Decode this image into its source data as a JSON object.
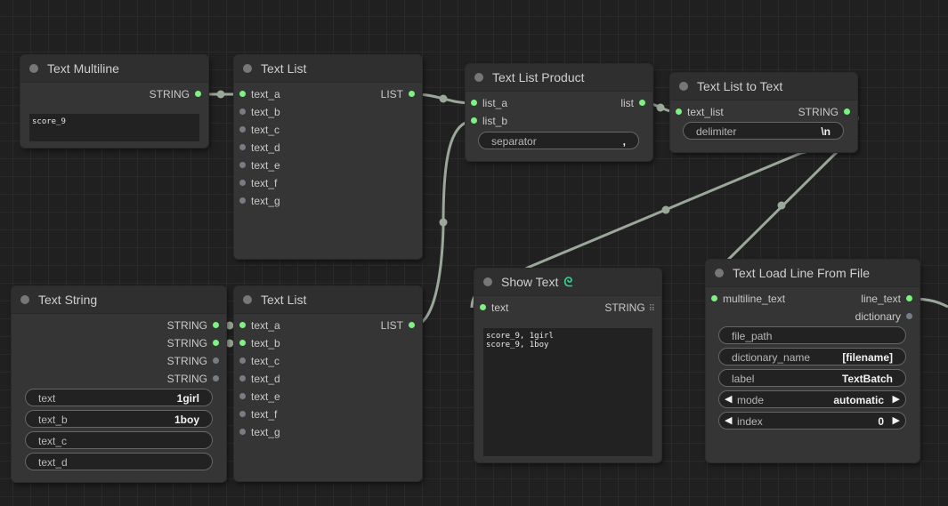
{
  "nodes": {
    "text_multiline": {
      "title": "Text Multiline",
      "output": "STRING",
      "text": "score_9"
    },
    "text_list_1": {
      "title": "Text List",
      "inputs": [
        "text_a",
        "text_b",
        "text_c",
        "text_d",
        "text_e",
        "text_f",
        "text_g"
      ],
      "output": "LIST"
    },
    "text_list_product": {
      "title": "Text List Product",
      "inputs": [
        "list_a",
        "list_b"
      ],
      "output": "list",
      "separator": {
        "label": "separator",
        "value": ","
      }
    },
    "text_list_to_text": {
      "title": "Text List to Text",
      "input": "text_list",
      "output": "STRING",
      "delimiter": {
        "label": "delimiter",
        "value": "\\n"
      }
    },
    "text_string": {
      "title": "Text String",
      "outputs": [
        "STRING",
        "STRING",
        "STRING",
        "STRING"
      ],
      "widgets": [
        {
          "label": "text",
          "value": "1girl"
        },
        {
          "label": "text_b",
          "value": "1boy"
        },
        {
          "label": "text_c",
          "value": ""
        },
        {
          "label": "text_d",
          "value": ""
        }
      ]
    },
    "text_list_2": {
      "title": "Text List",
      "inputs": [
        "text_a",
        "text_b",
        "text_c",
        "text_d",
        "text_e",
        "text_f",
        "text_g"
      ],
      "output": "LIST"
    },
    "show_text": {
      "title": "Show Text",
      "input": "text",
      "output": "STRING",
      "text": "score_9, 1girl\nscore_9, 1boy",
      "icon": "chain-link-icon"
    },
    "text_load_line": {
      "title": "Text Load Line From File",
      "input": "multiline_text",
      "outputs": [
        "line_text",
        "dictionary"
      ],
      "widgets": {
        "file_path": {
          "label": "file_path",
          "value": ""
        },
        "dictionary_name": {
          "label": "dictionary_name",
          "value": "[filename]"
        },
        "label": {
          "label": "label",
          "value": "TextBatch"
        },
        "mode": {
          "label": "mode",
          "value": "automatic"
        },
        "index": {
          "label": "index",
          "value": "0"
        }
      }
    }
  },
  "colors": {
    "wire": "#9aa89a",
    "slot_connected": "#7cf282",
    "slot_empty": "#777c85",
    "background": "#202020",
    "node": "#353535",
    "accent_icon": "#35d08f"
  },
  "icons": {
    "stepper_left": "◀",
    "stepper_right": "▶",
    "grid": "grid-icon"
  }
}
